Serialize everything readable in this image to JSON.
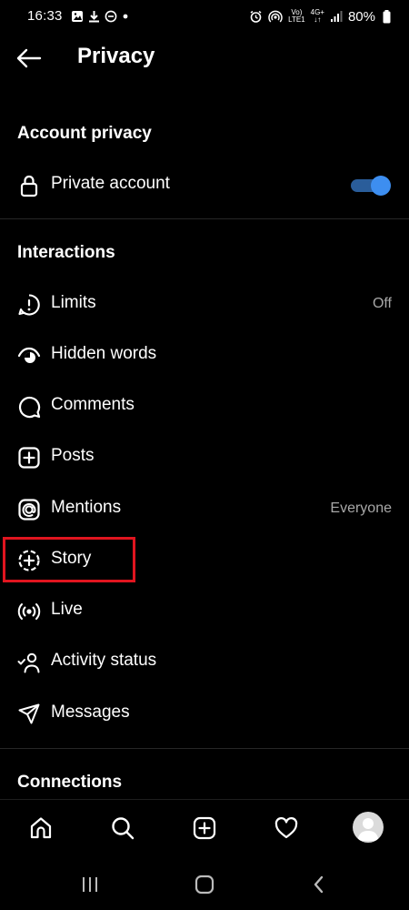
{
  "status_bar": {
    "time": "16:33",
    "battery": "80%",
    "left_icons": [
      "image-icon",
      "download-icon",
      "do-not-disturb-icon",
      "dot-icon"
    ],
    "right_icons": [
      "alarm-icon",
      "hotspot-icon",
      "volte-icon",
      "4g-icon",
      "signal-icon",
      "battery-icon"
    ],
    "volte_label_top": "Vo)",
    "volte_label_bottom": "LTE1",
    "net_label_top": "4G+",
    "net_label_bottom": "↓↑"
  },
  "header": {
    "title": "Privacy",
    "back_icon": "arrow-left-icon"
  },
  "account_privacy": {
    "section_title": "Account privacy",
    "private_account": {
      "label": "Private account",
      "icon": "lock-icon",
      "enabled": true,
      "accent_color": "#3d8ef0"
    }
  },
  "interactions": {
    "section_title": "Interactions",
    "items": [
      {
        "label": "Limits",
        "value": "Off",
        "icon": "limits-icon"
      },
      {
        "label": "Hidden words",
        "value": "",
        "icon": "hidden-words-icon"
      },
      {
        "label": "Comments",
        "value": "",
        "icon": "comment-icon"
      },
      {
        "label": "Posts",
        "value": "",
        "icon": "plus-square-icon"
      },
      {
        "label": "Mentions",
        "value": "Everyone",
        "icon": "at-sign-icon"
      },
      {
        "label": "Story",
        "value": "",
        "icon": "story-add-icon",
        "highlighted": true
      },
      {
        "label": "Live",
        "value": "",
        "icon": "live-icon"
      },
      {
        "label": "Activity status",
        "value": "",
        "icon": "activity-status-icon"
      },
      {
        "label": "Messages",
        "value": "",
        "icon": "paper-plane-icon"
      }
    ]
  },
  "connections": {
    "section_title": "Connections"
  },
  "bottom_nav": {
    "items": [
      "home-icon",
      "search-icon",
      "create-icon",
      "heart-icon",
      "profile-avatar"
    ]
  },
  "system_nav": {
    "items": [
      "recent-apps-icon",
      "home-button-icon",
      "back-icon"
    ]
  },
  "colors": {
    "background": "#000000",
    "text": "#ffffff",
    "secondary_text": "#a8a8a8",
    "highlight_border": "#e0151f",
    "divider": "#262626"
  }
}
